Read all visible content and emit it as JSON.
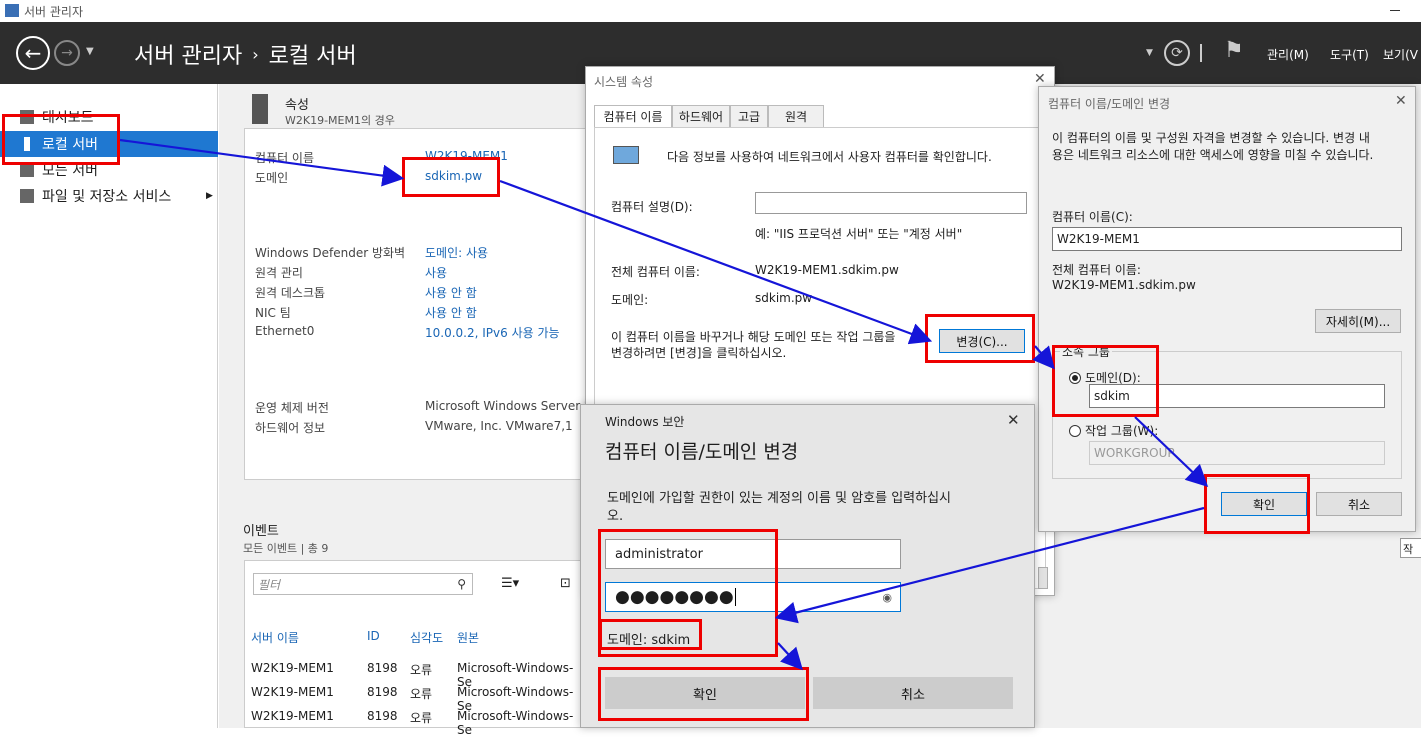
{
  "window_title": "서버 관리자",
  "header": {
    "breadcrumb_root": "서버 관리자",
    "breadcrumb_sep": "›",
    "breadcrumb_page": "로컬 서버",
    "menu": [
      "관리(M)",
      "도구(T)",
      "보기(V"
    ]
  },
  "sidebar": {
    "items": [
      {
        "label": "대시보드"
      },
      {
        "label": "로컬 서버"
      },
      {
        "label": "모든 서버"
      },
      {
        "label": "파일 및 저장소 서비스"
      }
    ]
  },
  "properties": {
    "title": "속성",
    "subtitle": "W2K19-MEM1의 경우",
    "rows1": [
      {
        "label": "컴퓨터 이름",
        "value": "W2K19-MEM1"
      },
      {
        "label": "도메인",
        "value": "sdkim.pw"
      }
    ],
    "rows2": [
      {
        "label": "Windows Defender 방화벽",
        "value": "도메인: 사용"
      },
      {
        "label": "원격 관리",
        "value": "사용"
      },
      {
        "label": "원격 데스크톱",
        "value": "사용 안 함"
      },
      {
        "label": "NIC 팀",
        "value": "사용 안 함"
      },
      {
        "label": "Ethernet0",
        "value": "10.0.0.2, IPv6 사용 가능"
      }
    ],
    "rows3": [
      {
        "label": "운영 체제 버전",
        "value": "Microsoft Windows Server 2"
      },
      {
        "label": "하드웨어 정보",
        "value": "VMware, Inc. VMware7,1"
      }
    ]
  },
  "events": {
    "title": "이벤트",
    "subtitle": "모든 이벤트 | 총 9",
    "filter_placeholder": "필터",
    "columns": [
      "서버 이름",
      "ID",
      "심각도",
      "원본"
    ],
    "rows": [
      [
        "W2K19-MEM1",
        "8198",
        "오류",
        "Microsoft-Windows-Se"
      ],
      [
        "W2K19-MEM1",
        "8198",
        "오류",
        "Microsoft-Windows-Se"
      ],
      [
        "W2K19-MEM1",
        "8198",
        "오류",
        "Microsoft-Windows-Se"
      ]
    ]
  },
  "sysprop": {
    "title": "시스템 속성",
    "tabs": [
      "컴퓨터 이름",
      "하드웨어",
      "고급",
      "원격"
    ],
    "info": "다음 정보를 사용하여 네트워크에서 사용자 컴퓨터를 확인합니다.",
    "desc_label": "컴퓨터 설명(D):",
    "desc_value": "",
    "example": "예: \"IIS 프로덕션 서버\" 또는 \"계정 서버\"",
    "full_label": "전체 컴퓨터 이름:",
    "full_value": "W2K19-MEM1.sdkim.pw",
    "domain_label": "도메인:",
    "domain_value": "sdkim.pw",
    "change_text_1": "이 컴퓨터 이름을 바꾸거나 해당 도메인 또는 작업 그룹을",
    "change_text_2": "변경하려면 [변경]을 클릭하십시오.",
    "change_button": "변경(C)..."
  },
  "rename": {
    "title": "컴퓨터 이름/도메인 변경",
    "desc_1": "이 컴퓨터의 이름 및 구성원 자격을 변경할 수 있습니다. 변경 내",
    "desc_2": "용은 네트워크 리소스에 대한 액세스에 영향을 미칠 수 있습니다.",
    "name_label": "컴퓨터 이름(C):",
    "name_value": "W2K19-MEM1",
    "full_label": "전체 컴퓨터 이름:",
    "full_value": "W2K19-MEM1.sdkim.pw",
    "more_button": "자세히(M)...",
    "member_label": "소속 그룹",
    "domain_radio": "도메인(D):",
    "domain_value": "sdkim",
    "workgroup_radio": "작업 그룹(W):",
    "workgroup_value": "WORKGROUP",
    "ok": "확인",
    "cancel": "취소"
  },
  "security": {
    "caption": "Windows 보안",
    "title": "컴퓨터 이름/도메인 변경",
    "desc_1": "도메인에 가입할 권한이 있는 계정의 이름 및 암호를 입력하십시",
    "desc_2": "오.",
    "username": "administrator",
    "password": "●●●●●●●●",
    "domain_note": "도메인: sdkim",
    "ok": "확인",
    "cancel": "취소"
  },
  "stub_right": "작"
}
